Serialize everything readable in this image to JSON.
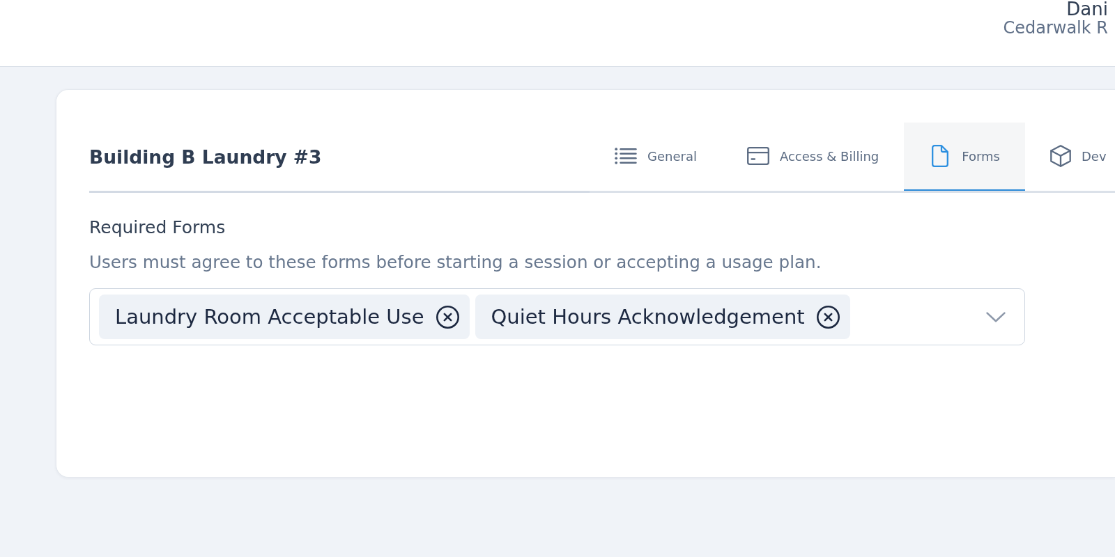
{
  "header": {
    "user_name": "Dani",
    "organization": "Cedarwalk R"
  },
  "card": {
    "title": "Building B Laundry #3",
    "tabs": [
      {
        "label": "General",
        "selected": false
      },
      {
        "label": "Access & Billing",
        "selected": false
      },
      {
        "label": "Forms",
        "selected": true
      },
      {
        "label": "Dev",
        "selected": false
      }
    ]
  },
  "required_forms": {
    "label": "Required Forms",
    "description": "Users must agree to these forms before starting a session or accepting a usage plan.",
    "selected_forms": [
      "Laundry Room Acceptable Use",
      "Quiet Hours Acknowledgement"
    ]
  }
}
